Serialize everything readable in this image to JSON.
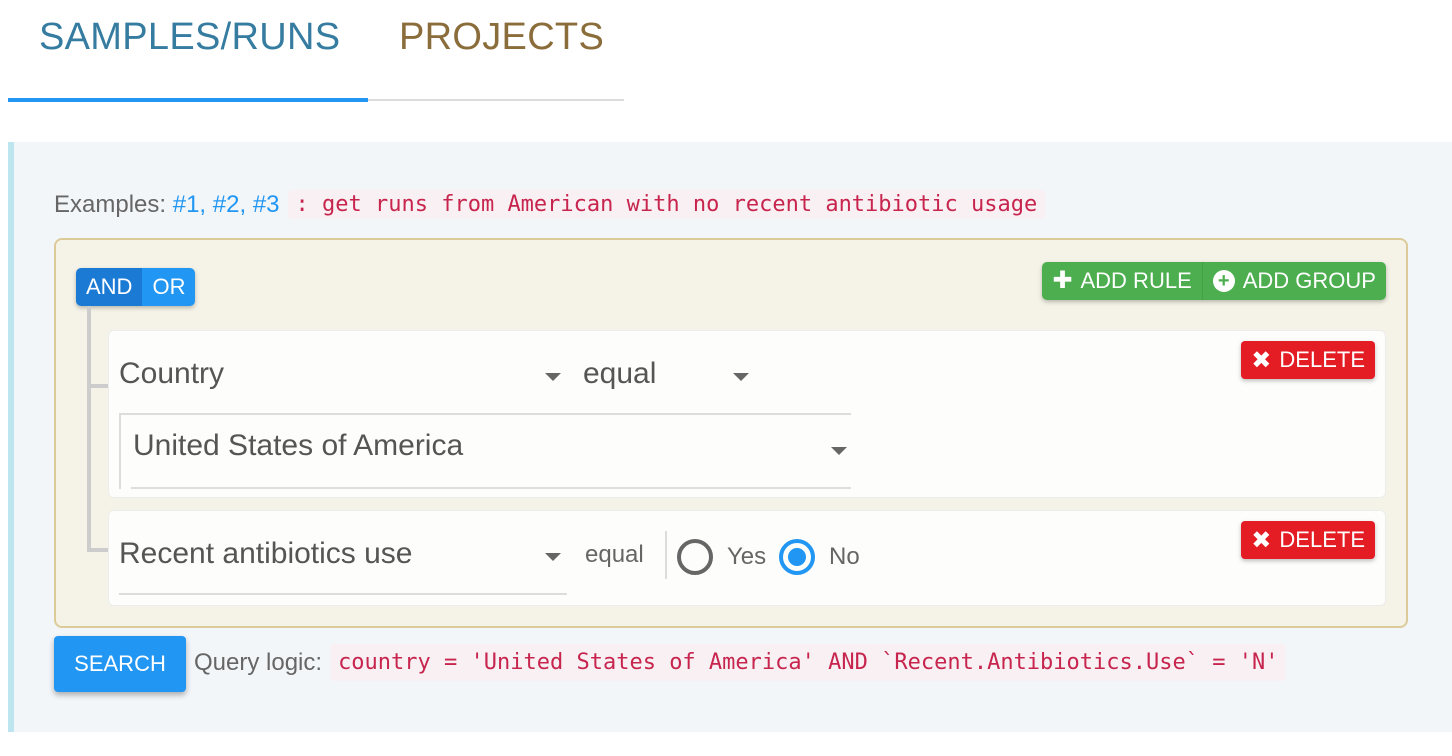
{
  "tabs": [
    {
      "label": "SAMPLES/RUNS",
      "active": true
    },
    {
      "label": "PROJECTS",
      "active": false
    }
  ],
  "examples": {
    "label": "Examples:",
    "links": [
      "#1,",
      "#2,",
      "#3"
    ],
    "description": ": get runs from American with no recent antibiotic usage"
  },
  "builder": {
    "conjunctions": [
      "AND",
      "OR"
    ],
    "selected_conjunction": "AND",
    "add_rule_label": "ADD RULE",
    "add_group_label": "ADD GROUP",
    "delete_label": "DELETE",
    "rules": [
      {
        "field": "Country",
        "operator": "equal",
        "value": "United States of America"
      },
      {
        "field": "Recent antibiotics use",
        "operator": "equal",
        "options": [
          "Yes",
          "No"
        ],
        "selected": "No"
      }
    ]
  },
  "search": {
    "button_label": "SEARCH",
    "query_label": "Query logic:",
    "query": "country = 'United States of America' AND `Recent.Antibiotics.Use` = 'N'"
  },
  "colors": {
    "tab_active": "#357ca0",
    "tab_inactive": "#8a6d3b",
    "indicator": "#2196f3",
    "success": "#4cae4f",
    "danger": "#e41c24",
    "primary": "#2196f3",
    "code": "#c7254e"
  }
}
